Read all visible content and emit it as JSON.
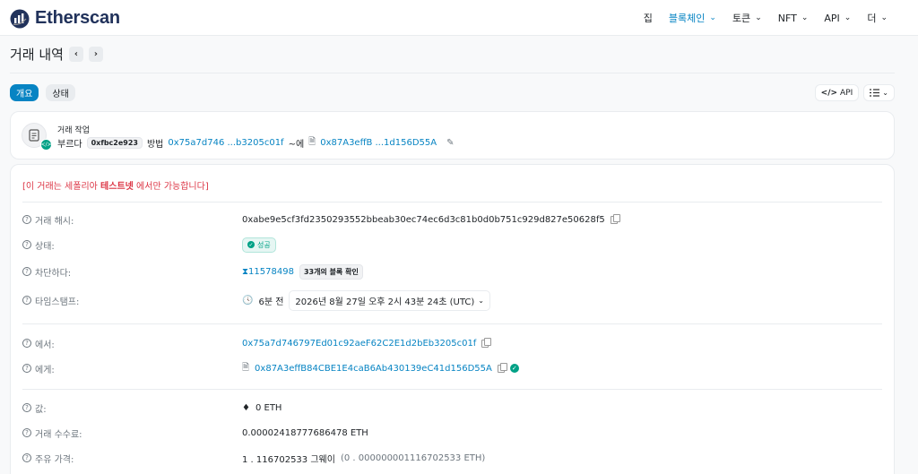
{
  "brand": {
    "name": "Etherscan",
    "color": "#21325b",
    "accent": "#0784c3"
  },
  "nav": [
    {
      "label": "집",
      "active": false,
      "dropdown": false
    },
    {
      "label": "블록체인",
      "active": true,
      "dropdown": true
    },
    {
      "label": "토큰",
      "active": false,
      "dropdown": true
    },
    {
      "label": "NFT",
      "active": false,
      "dropdown": true
    },
    {
      "label": "API",
      "active": false,
      "dropdown": true
    },
    {
      "label": "더",
      "active": false,
      "dropdown": true
    }
  ],
  "page": {
    "title": "거래 내역",
    "prev": "‹",
    "next": "›"
  },
  "tabs": [
    {
      "label": "개요",
      "active": true
    },
    {
      "label": "상태",
      "active": false
    }
  ],
  "tools": {
    "api_label": "API",
    "api_icon": "</>"
  },
  "action": {
    "label": "거래 작업",
    "verb": "부르다",
    "method_chip": "0xfbc2e923",
    "method_word": "방법",
    "from_short": "0x75a7d746 ...b3205c01f",
    "to_word": "~에",
    "to_short": "0x87A3effB ...1d156D55A"
  },
  "notice": {
    "prefix": "[이 거래는 세폴리아 ",
    "bold": "테스트넷",
    "suffix": " 에서만 가능합니다]"
  },
  "fields": {
    "hash": {
      "label": "거래 해시:",
      "value": "0xabe9e5cf3fd2350293552bbeab30ec74ec6d3c81b0d0b751c929d827e50628f5"
    },
    "status": {
      "label": "상태:",
      "value": "성공",
      "color": "#00a186"
    },
    "block": {
      "label": "차단하다:",
      "number": "11578498",
      "confirmations": "33개의 블록 확인"
    },
    "timestamp": {
      "label": "타임스탬프:",
      "relative": "6분 전",
      "absolute": "2026년 8월 27일 오후 2시 43분 24초 (UTC)"
    },
    "from": {
      "label": "에서:",
      "value": "0x75a7d746797Ed01c92aeF62C2E1d2bEb3205c01f"
    },
    "to": {
      "label": "에게:",
      "value": "0x87A3effB84CBE1E4caB6Ab430139eC41d156D55A"
    },
    "value": {
      "label": "값:",
      "value": "0 ETH"
    },
    "fee": {
      "label": "거래 수수료:",
      "value": "0.00002418777686478 ETH"
    },
    "gas": {
      "label": "주유 가격:",
      "value": "1 . 116702533 그웨이",
      "sub": "(0 . 000000001116702533 ETH)"
    }
  }
}
